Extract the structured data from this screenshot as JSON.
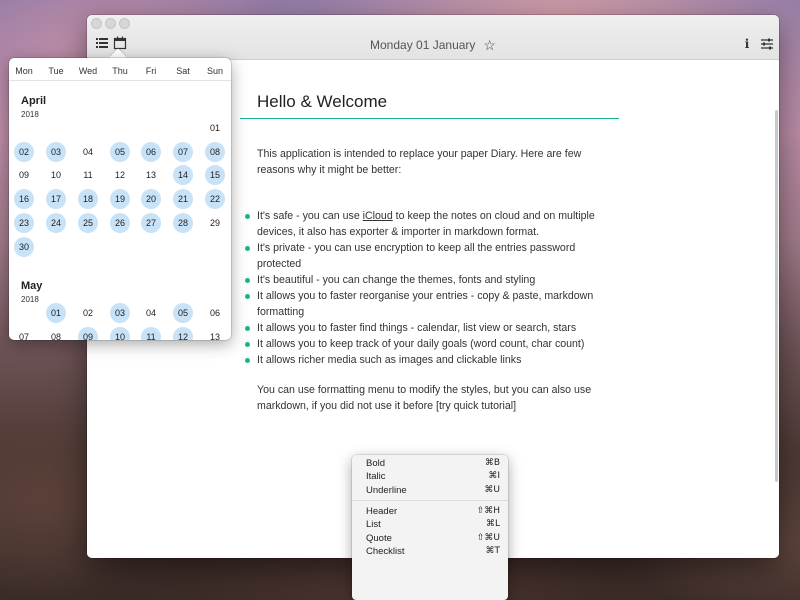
{
  "window": {
    "title": "Monday 01 January",
    "icons": {
      "list": "list-icon",
      "calendar": "calendar-icon",
      "star": "star-icon",
      "info": "info-icon",
      "settings": "sliders-icon"
    },
    "info_glyph": "i",
    "star_glyph": "☆"
  },
  "document": {
    "title": "Hello & Welcome",
    "intro": "This application is intended to replace your paper Diary. Here are few reasons why it might be better:",
    "bullets": [
      {
        "before": "It's safe - you can use ",
        "link": "iCloud",
        "after": " to keep the notes on cloud and on multiple devices, it also has exporter & importer in markdown format."
      },
      {
        "text": "It's private - you can use encryption to keep all the entries password protected"
      },
      {
        "text": "It's beautiful - you can change the themes, fonts  and styling"
      },
      {
        "text": "It allows you to faster reorganise your entries - copy & paste, markdown formatting"
      },
      {
        "text": "It allows you to faster find things - calendar, list view or search, stars"
      },
      {
        "text": "It allows you to keep track of your daily goals (word count, char count)"
      },
      {
        "text": "It allows richer media such as images and clickable links"
      }
    ],
    "outro": "You can use formatting menu to modify the styles, but you can also use markdown, if you did not use it before [try quick tutorial]",
    "accent_color": "#1bb38c"
  },
  "calendar": {
    "weekdays": [
      "Mon",
      "Tue",
      "Wed",
      "Thu",
      "Fri",
      "Sat",
      "Sun"
    ],
    "highlight_color": "#c8e2f7",
    "months": [
      {
        "name": "April",
        "year": "2018",
        "days": [
          {
            "d": "01",
            "h": false
          },
          {
            "d": "02",
            "h": true
          },
          {
            "d": "03",
            "h": true
          },
          {
            "d": "04",
            "h": false
          },
          {
            "d": "05",
            "h": true
          },
          {
            "d": "06",
            "h": true
          },
          {
            "d": "07",
            "h": true
          },
          {
            "d": "08",
            "h": true
          },
          {
            "d": "09",
            "h": false
          },
          {
            "d": "10",
            "h": false
          },
          {
            "d": "11",
            "h": false
          },
          {
            "d": "12",
            "h": false
          },
          {
            "d": "13",
            "h": false
          },
          {
            "d": "14",
            "h": true
          },
          {
            "d": "15",
            "h": true
          },
          {
            "d": "16",
            "h": true
          },
          {
            "d": "17",
            "h": true
          },
          {
            "d": "18",
            "h": true
          },
          {
            "d": "19",
            "h": true
          },
          {
            "d": "20",
            "h": true
          },
          {
            "d": "21",
            "h": true
          },
          {
            "d": "22",
            "h": true
          },
          {
            "d": "23",
            "h": true
          },
          {
            "d": "24",
            "h": true
          },
          {
            "d": "25",
            "h": true
          },
          {
            "d": "26",
            "h": true
          },
          {
            "d": "27",
            "h": true
          },
          {
            "d": "28",
            "h": true
          },
          {
            "d": "29",
            "h": false
          },
          {
            "d": "30",
            "h": true
          }
        ]
      },
      {
        "name": "May",
        "year": "2018",
        "days": [
          {
            "d": "01",
            "h": true
          },
          {
            "d": "02",
            "h": false
          },
          {
            "d": "03",
            "h": true
          },
          {
            "d": "04",
            "h": false
          },
          {
            "d": "05",
            "h": true
          },
          {
            "d": "06",
            "h": false
          },
          {
            "d": "07",
            "h": false
          },
          {
            "d": "08",
            "h": false
          },
          {
            "d": "09",
            "h": true
          },
          {
            "d": "10",
            "h": true
          },
          {
            "d": "11",
            "h": true
          },
          {
            "d": "12",
            "h": true
          },
          {
            "d": "13",
            "h": false
          }
        ]
      }
    ]
  },
  "format_menu": {
    "items": [
      {
        "label": "Bold",
        "shortcut": "⌘B"
      },
      {
        "label": "Italic",
        "shortcut": "⌘I"
      },
      {
        "label": "Underline",
        "shortcut": "⌘U"
      },
      {
        "label": "Header",
        "shortcut": "⇧⌘H"
      },
      {
        "label": "List",
        "shortcut": "⌘L"
      },
      {
        "label": "Quote",
        "shortcut": "⇧⌘U"
      },
      {
        "label": "Checklist",
        "shortcut": "⌘T"
      }
    ]
  }
}
